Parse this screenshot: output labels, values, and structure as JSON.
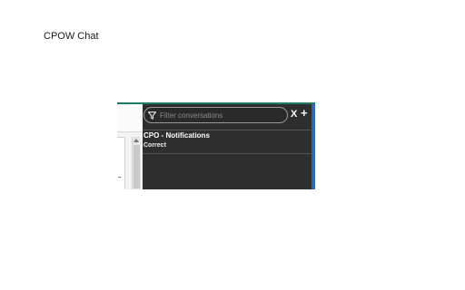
{
  "document": {
    "title": "CPOW Chat"
  },
  "chat": {
    "filter": {
      "placeholder": "Filter conversations",
      "value": ""
    },
    "close_label": "X",
    "add_label": "+",
    "conversations": [
      {
        "title": "CPO - Notifications",
        "preview": "Correct"
      }
    ]
  },
  "colors": {
    "panel_bg": "#2e2e2e",
    "accent_blue": "#2f66b8",
    "accent_teal": "#1f7a68"
  }
}
